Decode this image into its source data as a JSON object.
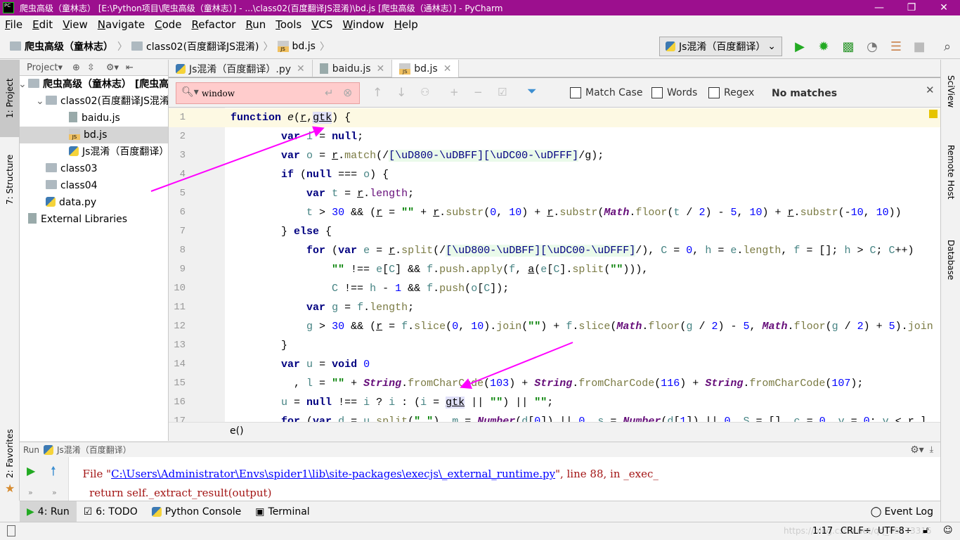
{
  "window": {
    "title": "爬虫高级（童林志） [E:\\Python项目\\爬虫高级（童林志）] - ...\\class02(百度翻译JS混淆)\\bd.js [爬虫高级（通林志）] - PyCharm",
    "app_icon": "PC"
  },
  "menu": [
    "File",
    "Edit",
    "View",
    "Navigate",
    "Code",
    "Refactor",
    "Run",
    "Tools",
    "VCS",
    "Window",
    "Help"
  ],
  "breadcrumb": [
    "爬虫高级（童林志）",
    "class02(百度翻译JS混淆)",
    "bd.js"
  ],
  "run_config": "Js混淆（百度翻译）",
  "toolbar_icons": [
    "run-icon",
    "debug-icon",
    "coverage-icon",
    "profile-icon",
    "concurrency-icon",
    "stop-icon",
    "search-icon"
  ],
  "project": {
    "header": "Project▾",
    "tree": [
      {
        "label": "爬虫高级（童林志） [爬虫高",
        "type": "folder",
        "depth": 0,
        "bold": true
      },
      {
        "label": "class02(百度翻译JS混淆",
        "type": "folder",
        "depth": 1
      },
      {
        "label": "baidu.js",
        "type": "txt",
        "depth": 2
      },
      {
        "label": "bd.js",
        "type": "js",
        "depth": 2,
        "selected": true
      },
      {
        "label": "Js混淆（百度翻译）",
        "type": "py",
        "depth": 2
      },
      {
        "label": "class03",
        "type": "folder",
        "depth": 1
      },
      {
        "label": "class04",
        "type": "folder",
        "depth": 1
      },
      {
        "label": "data.py",
        "type": "py",
        "depth": 1
      },
      {
        "label": "External Libraries",
        "type": "lib",
        "depth": 0
      }
    ]
  },
  "left_tabs": [
    "1: Project",
    "7: Structure",
    "2: Favorites"
  ],
  "right_tabs": [
    "SciView",
    "Remote Host",
    "Database"
  ],
  "tabs": [
    {
      "label": "Js混淆（百度翻译）.py",
      "icon": "py"
    },
    {
      "label": "baidu.js",
      "icon": "txt"
    },
    {
      "label": "bd.js",
      "icon": "js",
      "active": true
    }
  ],
  "find": {
    "value": "window",
    "match_case": "Match Case",
    "words": "Words",
    "regex": "Regex",
    "status": "No matches"
  },
  "code": [
    [
      [
        "function",
        "k"
      ],
      [
        " "
      ],
      [
        "e",
        "it"
      ],
      [
        "("
      ],
      [
        "r",
        "u"
      ],
      [
        ","
      ],
      [
        "gtk",
        "uh"
      ],
      [
        ") {"
      ]
    ],
    [
      [
        "        "
      ],
      [
        "var",
        "k"
      ],
      [
        " "
      ],
      [
        "i",
        "v"
      ],
      [
        " = "
      ],
      [
        "null",
        "k"
      ],
      [
        ";"
      ]
    ],
    [
      [
        "        "
      ],
      [
        "var",
        "k"
      ],
      [
        " "
      ],
      [
        "o",
        "v"
      ],
      [
        " = "
      ],
      [
        "r",
        "u"
      ],
      [
        "."
      ],
      [
        "match",
        "m"
      ],
      [
        "(/"
      ],
      [
        "[\\uD800-\\uDBFF][\\uDC00-\\uDFFF]",
        "re"
      ],
      [
        "/g);"
      ]
    ],
    [
      [
        "        "
      ],
      [
        "if",
        "k"
      ],
      [
        " ("
      ],
      [
        "null",
        "k"
      ],
      [
        " === "
      ],
      [
        "o",
        "v"
      ],
      [
        ") {"
      ]
    ],
    [
      [
        "            "
      ],
      [
        "var",
        "k"
      ],
      [
        " "
      ],
      [
        "t",
        "v"
      ],
      [
        " = "
      ],
      [
        "r",
        "u"
      ],
      [
        "."
      ],
      [
        "length",
        "f"
      ],
      [
        ";"
      ]
    ],
    [
      [
        "            "
      ],
      [
        "t",
        "v"
      ],
      [
        " > "
      ],
      [
        "30",
        "n"
      ],
      [
        " && ("
      ],
      [
        "r",
        "u"
      ],
      [
        " = "
      ],
      [
        "\"\"",
        "s"
      ],
      [
        " + "
      ],
      [
        "r",
        "u"
      ],
      [
        "."
      ],
      [
        "substr",
        "m"
      ],
      [
        "("
      ],
      [
        "0",
        "n"
      ],
      [
        ", "
      ],
      [
        "10",
        "n"
      ],
      [
        ") + "
      ],
      [
        "r",
        "u"
      ],
      [
        "."
      ],
      [
        "substr",
        "m"
      ],
      [
        "("
      ],
      [
        "Math",
        "cl"
      ],
      [
        "."
      ],
      [
        "floor",
        "m"
      ],
      [
        "("
      ],
      [
        "t",
        "v"
      ],
      [
        " / "
      ],
      [
        "2",
        "n"
      ],
      [
        ") - "
      ],
      [
        "5",
        "n"
      ],
      [
        ", "
      ],
      [
        "10",
        "n"
      ],
      [
        ") + "
      ],
      [
        "r",
        "u"
      ],
      [
        "."
      ],
      [
        "substr",
        "m"
      ],
      [
        "(-"
      ],
      [
        "10",
        "n"
      ],
      [
        ", "
      ],
      [
        "10",
        "n"
      ],
      [
        "))"
      ]
    ],
    [
      [
        "        "
      ],
      [
        "} "
      ],
      [
        "else",
        "k"
      ],
      [
        " {"
      ]
    ],
    [
      [
        "            "
      ],
      [
        "for",
        "k"
      ],
      [
        " ("
      ],
      [
        "var",
        "k"
      ],
      [
        " "
      ],
      [
        "e",
        "v"
      ],
      [
        " = "
      ],
      [
        "r",
        "u"
      ],
      [
        "."
      ],
      [
        "split",
        "m"
      ],
      [
        "(/"
      ],
      [
        "[\\uD800-\\uDBFF][\\uDC00-\\uDFFF]",
        "re"
      ],
      [
        "/), "
      ],
      [
        "C",
        "v"
      ],
      [
        " = "
      ],
      [
        "0",
        "n"
      ],
      [
        ", "
      ],
      [
        "h",
        "v"
      ],
      [
        " = "
      ],
      [
        "e",
        "v"
      ],
      [
        "."
      ],
      [
        "length",
        "m"
      ],
      [
        ", "
      ],
      [
        "f",
        "v"
      ],
      [
        " = []; "
      ],
      [
        "h",
        "v"
      ],
      [
        " > "
      ],
      [
        "C",
        "v"
      ],
      [
        "; "
      ],
      [
        "C",
        "v"
      ],
      [
        "++)"
      ]
    ],
    [
      [
        "                "
      ],
      [
        "\"\"",
        "s"
      ],
      [
        " !== "
      ],
      [
        "e",
        "v"
      ],
      [
        "["
      ],
      [
        "C",
        "v"
      ],
      [
        "] && "
      ],
      [
        "f",
        "v"
      ],
      [
        "."
      ],
      [
        "push",
        "m"
      ],
      [
        "."
      ],
      [
        "apply",
        "m"
      ],
      [
        "("
      ],
      [
        "f",
        "v"
      ],
      [
        ", "
      ],
      [
        "a",
        "u"
      ],
      [
        "("
      ],
      [
        "e",
        "v"
      ],
      [
        "["
      ],
      [
        "C",
        "v"
      ],
      [
        "]."
      ],
      [
        "split",
        "m"
      ],
      [
        "("
      ],
      [
        "\"\"",
        "s"
      ],
      [
        ")))"
      ],
      [
        ",",
        ""
      ]
    ],
    [
      [
        "                "
      ],
      [
        "C",
        "v"
      ],
      [
        " !== "
      ],
      [
        "h",
        "v"
      ],
      [
        " - "
      ],
      [
        "1",
        "n"
      ],
      [
        " && "
      ],
      [
        "f",
        "v"
      ],
      [
        "."
      ],
      [
        "push",
        "m"
      ],
      [
        "("
      ],
      [
        "o",
        "v"
      ],
      [
        "["
      ],
      [
        "C",
        "v"
      ],
      [
        "]);"
      ]
    ],
    [
      [
        "            "
      ],
      [
        "var",
        "k"
      ],
      [
        " "
      ],
      [
        "g",
        "v"
      ],
      [
        " = "
      ],
      [
        "f",
        "v"
      ],
      [
        "."
      ],
      [
        "length",
        "m"
      ],
      [
        ";"
      ]
    ],
    [
      [
        "            "
      ],
      [
        "g",
        "v"
      ],
      [
        " > "
      ],
      [
        "30",
        "n"
      ],
      [
        " && ("
      ],
      [
        "r",
        "u"
      ],
      [
        " = "
      ],
      [
        "f",
        "v"
      ],
      [
        "."
      ],
      [
        "slice",
        "m"
      ],
      [
        "("
      ],
      [
        "0",
        "n"
      ],
      [
        ", "
      ],
      [
        "10",
        "n"
      ],
      [
        ")."
      ],
      [
        "join",
        "m"
      ],
      [
        "("
      ],
      [
        "\"\"",
        "s"
      ],
      [
        ") + "
      ],
      [
        "f",
        "v"
      ],
      [
        "."
      ],
      [
        "slice",
        "m"
      ],
      [
        "("
      ],
      [
        "Math",
        "cl"
      ],
      [
        "."
      ],
      [
        "floor",
        "m"
      ],
      [
        "("
      ],
      [
        "g",
        "v"
      ],
      [
        " / "
      ],
      [
        "2",
        "n"
      ],
      [
        ") - "
      ],
      [
        "5",
        "n"
      ],
      [
        ", "
      ],
      [
        "Math",
        "cl"
      ],
      [
        "."
      ],
      [
        "floor",
        "m"
      ],
      [
        "("
      ],
      [
        "g",
        "v"
      ],
      [
        " / "
      ],
      [
        "2",
        "n"
      ],
      [
        ") + "
      ],
      [
        "5",
        "n"
      ],
      [
        ")."
      ],
      [
        "join",
        "m"
      ]
    ],
    [
      [
        "        "
      ],
      [
        "}"
      ]
    ],
    [
      [
        "        "
      ],
      [
        "var",
        "k"
      ],
      [
        " "
      ],
      [
        "u",
        "v"
      ],
      [
        " = "
      ],
      [
        "void",
        "k"
      ],
      [
        " "
      ],
      [
        "0",
        "n"
      ]
    ],
    [
      [
        "          , "
      ],
      [
        "l",
        "v"
      ],
      [
        " = "
      ],
      [
        "\"\"",
        "s"
      ],
      [
        " + "
      ],
      [
        "String",
        "cl"
      ],
      [
        "."
      ],
      [
        "fromCharCode",
        "m"
      ],
      [
        "("
      ],
      [
        "103",
        "n"
      ],
      [
        ") + "
      ],
      [
        "String",
        "cl"
      ],
      [
        "."
      ],
      [
        "fromCharCode",
        "m"
      ],
      [
        "("
      ],
      [
        "116",
        "n"
      ],
      [
        ") + "
      ],
      [
        "String",
        "cl"
      ],
      [
        "."
      ],
      [
        "fromCharCode",
        "m"
      ],
      [
        "("
      ],
      [
        "107",
        "n"
      ],
      [
        ");"
      ]
    ],
    [
      [
        "        "
      ],
      [
        "u",
        "v"
      ],
      [
        " = "
      ],
      [
        "null",
        "k"
      ],
      [
        " !== "
      ],
      [
        "i",
        "v"
      ],
      [
        " ? "
      ],
      [
        "i",
        "v"
      ],
      [
        " : ("
      ],
      [
        "i",
        "v"
      ],
      [
        " = "
      ],
      [
        "gtk",
        "uh"
      ],
      [
        " || "
      ],
      [
        "\"\"",
        "s"
      ],
      [
        ") || "
      ],
      [
        "\"\"",
        "s"
      ],
      [
        ";"
      ]
    ],
    [
      [
        "        "
      ],
      [
        "for",
        "k"
      ],
      [
        " ("
      ],
      [
        "var",
        "k"
      ],
      [
        " "
      ],
      [
        "d",
        "v"
      ],
      [
        " = "
      ],
      [
        "u",
        "v"
      ],
      [
        "."
      ],
      [
        "split",
        "m"
      ],
      [
        "("
      ],
      [
        "\".\"",
        "s"
      ],
      [
        "), "
      ],
      [
        "m",
        "v"
      ],
      [
        " = "
      ],
      [
        "Number",
        "cl"
      ],
      [
        "("
      ],
      [
        "d",
        "v"
      ],
      [
        "["
      ],
      [
        "0",
        "n"
      ],
      [
        "]) || "
      ],
      [
        "0",
        "n"
      ],
      [
        ", "
      ],
      [
        "s",
        "v"
      ],
      [
        " = "
      ],
      [
        "Number",
        "cl"
      ],
      [
        "("
      ],
      [
        "d",
        "v"
      ],
      [
        "["
      ],
      [
        "1",
        "n"
      ],
      [
        "]) || "
      ],
      [
        "0",
        "n"
      ],
      [
        ", "
      ],
      [
        "S",
        "v"
      ],
      [
        " = [], "
      ],
      [
        "c",
        "v"
      ],
      [
        " = "
      ],
      [
        "0",
        "n"
      ],
      [
        ", "
      ],
      [
        "v",
        "v"
      ],
      [
        " = "
      ],
      [
        "0",
        "n"
      ],
      [
        "; "
      ],
      [
        "v",
        "v"
      ],
      [
        " < "
      ],
      [
        "r",
        "u"
      ],
      [
        ".l"
      ]
    ]
  ],
  "code_breadcrumb": "e()",
  "run": {
    "label": "Run",
    "config": "Js混淆（百度翻译）",
    "output": [
      {
        "prefix": "  File \"",
        "link": "C:\\Users\\Administrator\\Envs\\spider1\\lib\\site-packages\\execjs\\_external_runtime.py",
        "suffix": "\", line 88, in _exec_"
      },
      {
        "text": "    return self._extract_result(output)"
      }
    ]
  },
  "tool_windows": [
    {
      "label": "4: Run",
      "active": true
    },
    {
      "label": "6: TODO"
    },
    {
      "label": "Python Console"
    },
    {
      "label": "Terminal"
    }
  ],
  "event_log": "Event Log",
  "status": {
    "position": "1:17",
    "line_sep": "CRLF÷",
    "encoding": "UTF-8÷",
    "watermark": "https://blog.csdn.net/qq_45173315"
  },
  "colors": {
    "title_bar": "#9c0f8e",
    "annotation_arrow": "#ff00ff",
    "find_no_match_bg": "#ffcccc"
  }
}
